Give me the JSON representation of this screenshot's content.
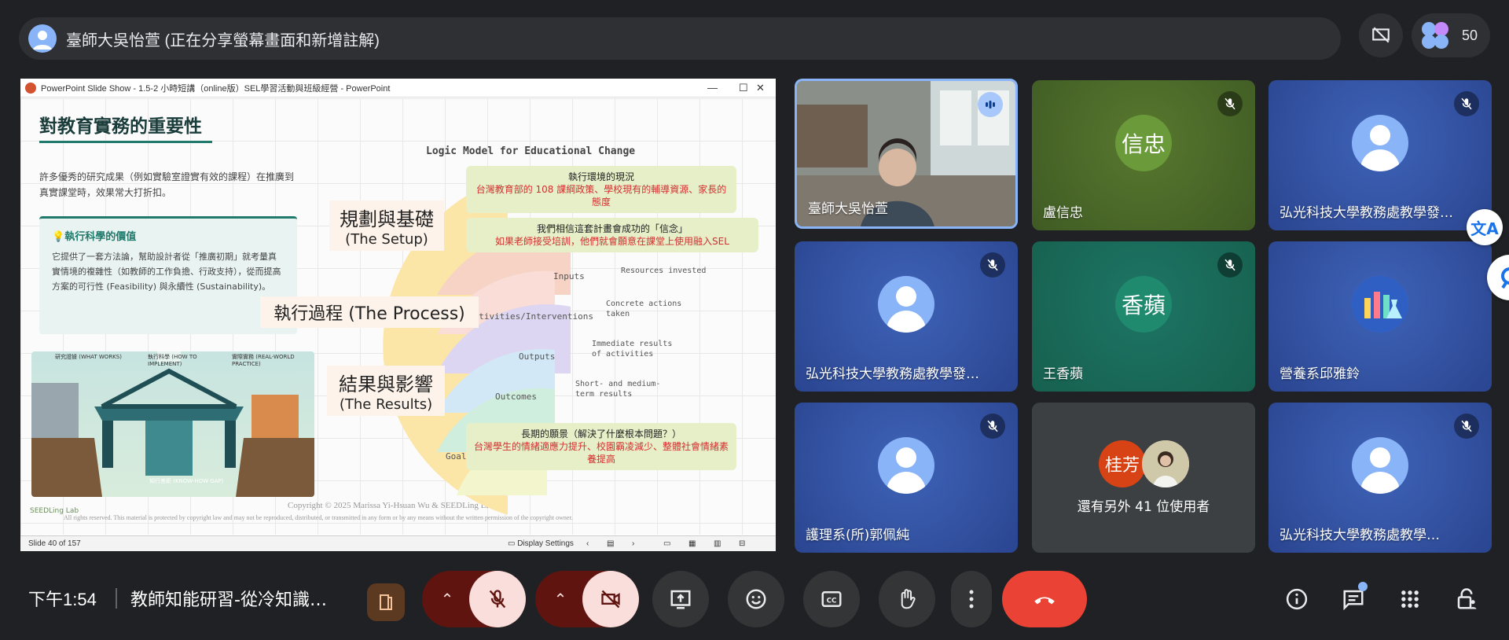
{
  "top": {
    "presenter_title": "臺師大吳怡萱 (正在分享螢幕畫面和新增註解)",
    "participant_count": "50"
  },
  "window": {
    "title": "PowerPoint Slide Show  -  1.5-2 小時短講（online版）SEL學習活動與班級經營 - PowerPoint",
    "slide_counter": "Slide 40 of 157",
    "display_settings": "Display Settings"
  },
  "slide": {
    "title": "對教育實務的重要性",
    "intro": "許多優秀的研究成果（例如實驗室證實有效的課程）在推廣到真實課堂時，效果常大打折扣。",
    "box_title": "執行科學的價值",
    "box_body": "它提供了一套方法論，幫助設計者從「推廣初期」就考量真實情境的複雜性（如教師的工作負擔、行政支持），從而提高方案的可行性 (Feasibility) 與永續性 (Sustainability)。",
    "logic_title": "Logic Model for Educational Change",
    "stage1_zh": "規劃與基礎",
    "stage1_en": "(The Setup)",
    "stage2_zh": "執行過程 (The Process)",
    "stage3_zh": "結果與影響",
    "stage3_en": "(The Results)",
    "callout1_title": "執行環境的現況",
    "callout1_body": "台灣教育部的 108 課綱政策、學校現有的輔導資源、家長的態度",
    "callout2_title": "我們相信這套計畫會成功的「信念」",
    "callout2_body": "如果老師接受培訓，他們就會願意在課堂上使用融入SEL",
    "callout3_title": "長期的願景（解決了什麼根本問題？）",
    "callout3_body": "台灣學生的情緒適應力提升、校園霸凌減少、整體社會情緒素養提高",
    "arc_inputs": "Inputs",
    "arc_activities": "Activities/Interventions",
    "arc_outputs": "Outputs",
    "arc_outcomes": "Outcomes",
    "arc_goal": "Goal",
    "res_invested": "Resources invested",
    "res_actions": "Concrete actions taken",
    "res_immediate": "Immediate results of activities",
    "res_short": "Short- and medium-term results",
    "illus_label_left": "研究證據 (WHAT WORKS)",
    "illus_label_mid": "執行科學 (HOW TO IMPLEMENT)",
    "illus_label_right": "實際實務 (REAL-WORLD PRACTICE)",
    "illus_gap": "知行差距 (KNOW-HOW GAP)",
    "logo_text": "SEEDLing Lab",
    "copyright": "Copyright © 2025 Marissa Yi-Hsuan Wu & SEEDLing Lab",
    "rights": "All rights reserved. This material is protected by copyright law and may not be reproduced, distributed, or transmitted in any form or by any means without the written permission of the copyright owner."
  },
  "tiles": [
    {
      "name": "臺師大吳怡萱",
      "type": "video"
    },
    {
      "name": "盧信忠",
      "initial": "信忠",
      "color": "#6a9a3a",
      "bg": "#3f5b24"
    },
    {
      "name": "弘光科技大學教務處教學發…",
      "type": "person"
    },
    {
      "name": "弘光科技大學教務處教學發…",
      "type": "person"
    },
    {
      "name": "王香蘋",
      "initial": "香蘋",
      "color": "#1f8a6e",
      "bg": "#17604f"
    },
    {
      "name": "營養系邱雅鈴",
      "type": "image"
    },
    {
      "name": "護理系(所)郭佩純",
      "type": "person"
    },
    {
      "name": "還有另外 41 位使用者",
      "initial": "桂芳",
      "color": "#d84315"
    },
    {
      "name": "弘光科技大學教務處教學…",
      "type": "person"
    }
  ],
  "bottom": {
    "time": "下午1:54",
    "meeting": "教師知能研習-從冷知識…"
  },
  "colors": {
    "accent_blue": "#8ab4f8",
    "hangup_red": "#ea4335",
    "mic_off_bg": "#f9dedc",
    "mic_off_dark": "#601410"
  }
}
